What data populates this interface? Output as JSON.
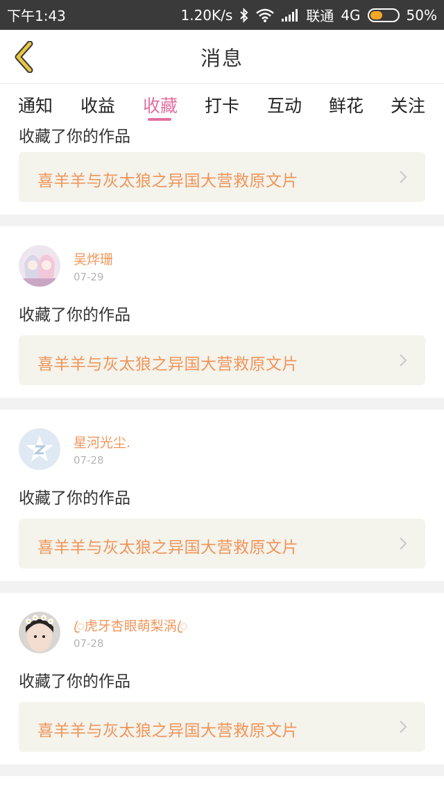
{
  "status": {
    "time": "下午1:43",
    "speed": "1.20K/s",
    "carrier": "联通",
    "network": "4G",
    "battery": "50%",
    "battery_level": 0.5,
    "bluetooth_icon": "bluetooth-icon",
    "wifi_icon": "wifi-icon",
    "signal_icon": "signal-icon"
  },
  "header": {
    "title": "消息",
    "back_icon": "chevron-left-icon"
  },
  "tabs": [
    "通知",
    "收益",
    "收藏",
    "打卡",
    "互动",
    "鲜花",
    "关注"
  ],
  "active_tab": "收藏",
  "first_card": {
    "text": "收藏了你的作品",
    "work_title": "喜羊羊与灰太狼之异国大营救原文片"
  },
  "messages": [
    {
      "user": "吴烨珊",
      "date": "07-29",
      "text": "收藏了你的作品",
      "work_title": "喜羊羊与灰太狼之异国大营救原文片",
      "avatar": "anime-girls-avatar"
    },
    {
      "user": "星河光尘.",
      "date": "07-28",
      "text": "收藏了你的作品",
      "work_title": "喜羊羊与灰太狼之异国大营救原文片",
      "avatar": "default-z-avatar"
    },
    {
      "user": "ꦿ虎牙杏眼萌梨涡ꦿ",
      "date": "07-28",
      "text": "收藏了你的作品",
      "work_title": "喜羊羊与灰太狼之异国大营救原文片",
      "avatar": "flower-crown-avatar"
    }
  ],
  "colors": {
    "accent": "#e36fa2",
    "orange": "#f0955a",
    "status_bar": "#3a3a3a",
    "link_bg": "#f4f3ec",
    "back_arrow": "#e9c640"
  }
}
